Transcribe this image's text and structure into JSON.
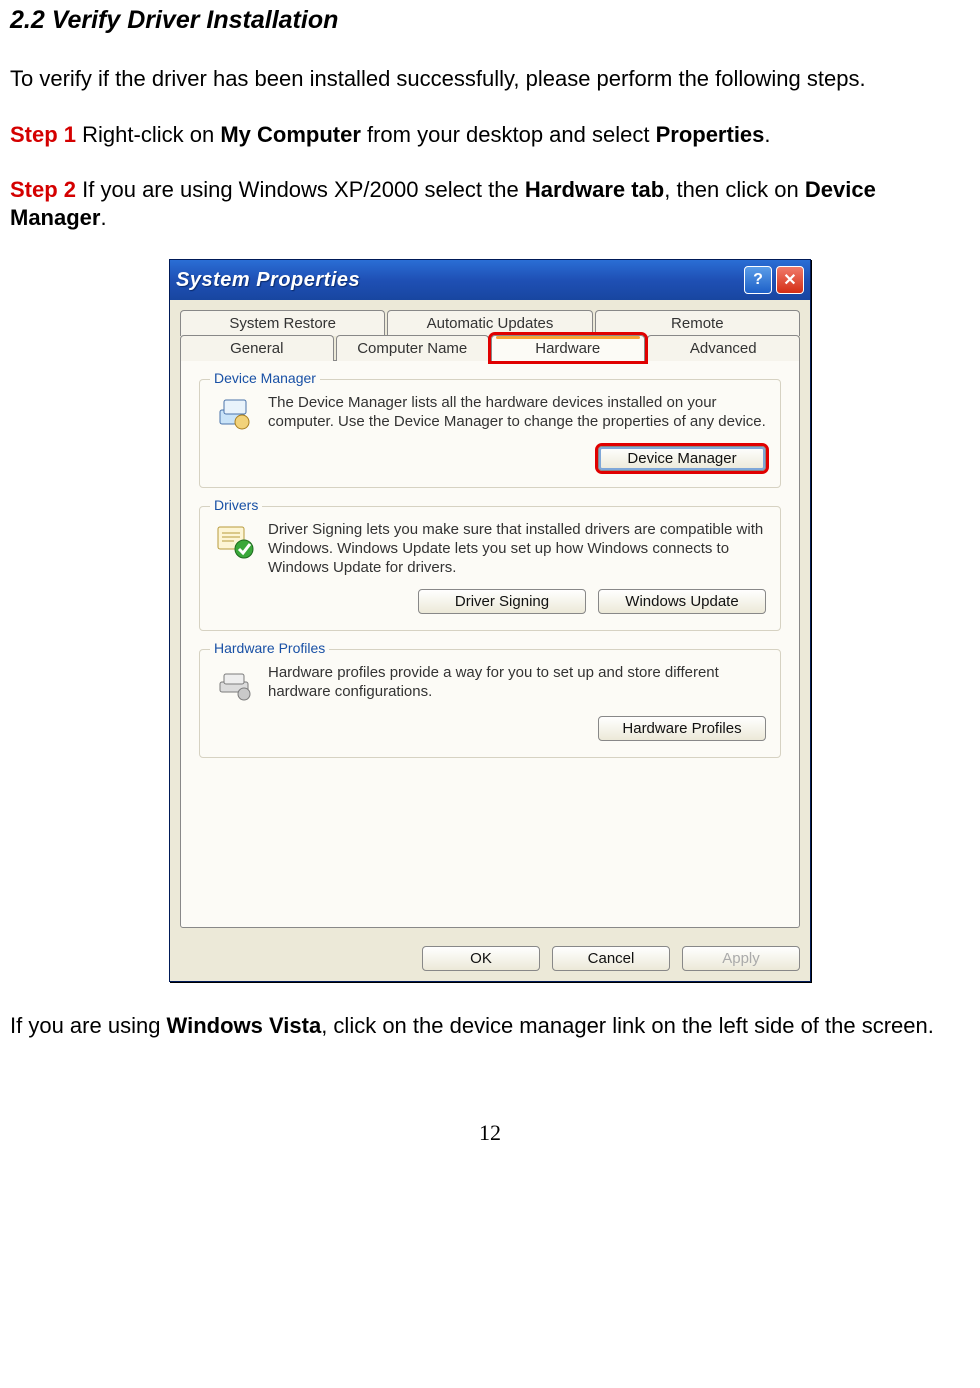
{
  "doc": {
    "section_heading": "2.2 Verify Driver Installation",
    "intro": "To verify if the driver has been installed successfully, please perform the following steps.",
    "step1": {
      "label": "Step 1",
      "pre": " Right-click on ",
      "b1": "My Computer",
      "mid": " from your desktop and select ",
      "b2": "Properties",
      "post": "."
    },
    "step2": {
      "label": "Step 2",
      "pre": " If you are using Windows XP/2000 select the ",
      "b1": "Hardware tab",
      "mid": ", then click on ",
      "b2": "Device Manager",
      "post": "."
    },
    "vista": {
      "pre": "If you are using ",
      "b1": "Windows Vista",
      "post": ", click on the device manager link on the left side of the screen."
    },
    "page_number": "12"
  },
  "dialog": {
    "title": "System Properties",
    "tabs_row1": [
      "System Restore",
      "Automatic Updates",
      "Remote"
    ],
    "tabs_row2": [
      "General",
      "Computer Name",
      "Hardware",
      "Advanced"
    ],
    "group_dm": {
      "label": "Device Manager",
      "text": "The Device Manager lists all the hardware devices installed on your computer. Use the Device Manager to change the properties of any device.",
      "button": "Device Manager"
    },
    "group_drv": {
      "label": "Drivers",
      "text": "Driver Signing lets you make sure that installed drivers are compatible with Windows. Windows Update lets you set up how Windows connects to Windows Update for drivers.",
      "btn1": "Driver Signing",
      "btn2": "Windows Update"
    },
    "group_hw": {
      "label": "Hardware Profiles",
      "text": "Hardware profiles provide a way for you to set up and store different hardware configurations.",
      "button": "Hardware Profiles"
    },
    "ok": "OK",
    "cancel": "Cancel",
    "apply": "Apply"
  }
}
